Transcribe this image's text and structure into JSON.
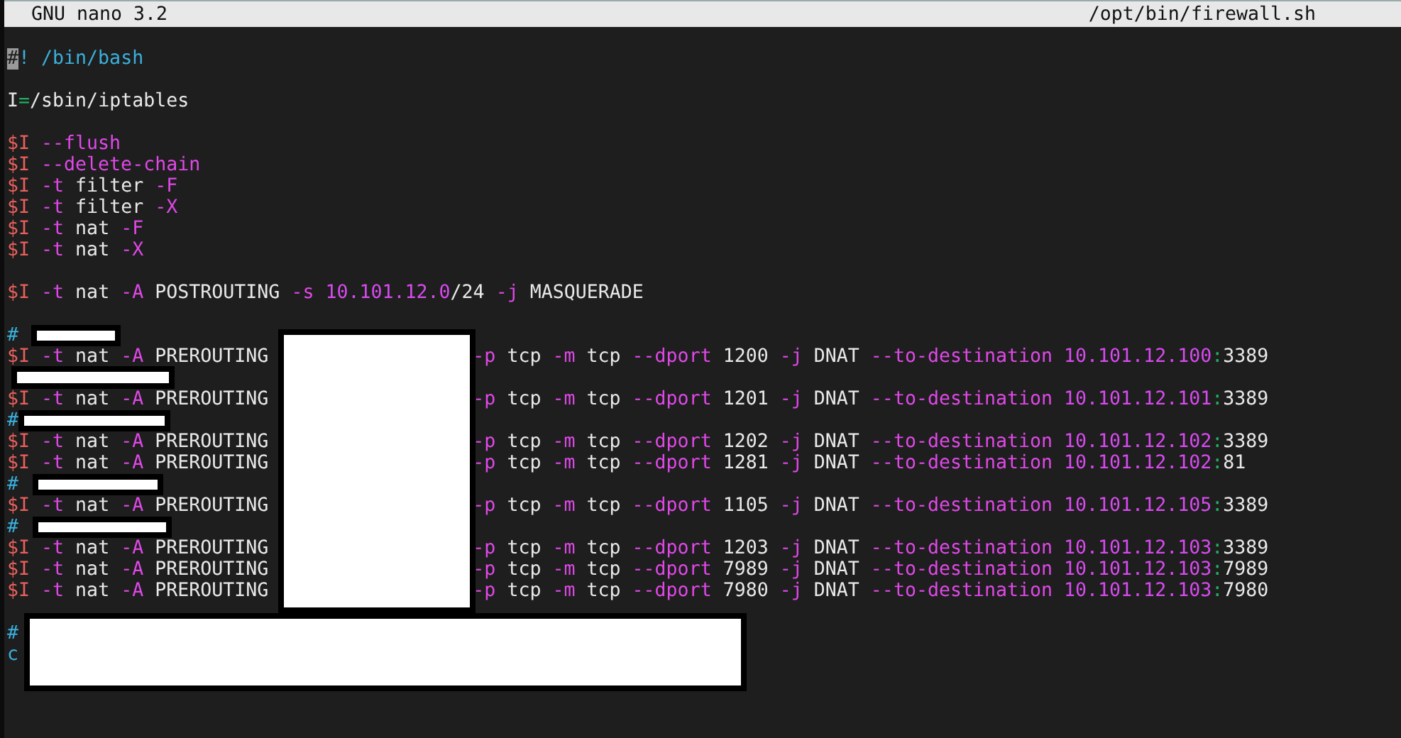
{
  "title_bar": {
    "app": "GNU nano 3.2",
    "file": "/opt/bin/firewall.sh"
  },
  "lines": [
    {
      "kind": "code",
      "segments": [
        {
          "kind": "cursor",
          "text": "#"
        },
        {
          "kind": "comment",
          "text": "! /bin/bash"
        }
      ]
    },
    {
      "kind": "blank"
    },
    {
      "kind": "code",
      "segments": [
        {
          "kind": "plain",
          "text": "I"
        },
        {
          "kind": "op",
          "text": "="
        },
        {
          "kind": "plain",
          "text": "/sbin/iptables"
        }
      ]
    },
    {
      "kind": "blank"
    },
    {
      "kind": "code",
      "segments": [
        {
          "kind": "var",
          "text": "$I"
        },
        {
          "kind": "opt",
          "text": " --flush"
        }
      ]
    },
    {
      "kind": "code",
      "segments": [
        {
          "kind": "var",
          "text": "$I"
        },
        {
          "kind": "opt",
          "text": " --delete-chain"
        }
      ]
    },
    {
      "kind": "code",
      "segments": [
        {
          "kind": "var",
          "text": "$I"
        },
        {
          "kind": "opt",
          "text": " -t"
        },
        {
          "kind": "plain",
          "text": " filter"
        },
        {
          "kind": "opt",
          "text": " -F"
        }
      ]
    },
    {
      "kind": "code",
      "segments": [
        {
          "kind": "var",
          "text": "$I"
        },
        {
          "kind": "opt",
          "text": " -t"
        },
        {
          "kind": "plain",
          "text": " filter"
        },
        {
          "kind": "opt",
          "text": " -X"
        }
      ]
    },
    {
      "kind": "code",
      "segments": [
        {
          "kind": "var",
          "text": "$I"
        },
        {
          "kind": "opt",
          "text": " -t"
        },
        {
          "kind": "plain",
          "text": " nat"
        },
        {
          "kind": "opt",
          "text": " -F"
        }
      ]
    },
    {
      "kind": "code",
      "segments": [
        {
          "kind": "var",
          "text": "$I"
        },
        {
          "kind": "opt",
          "text": " -t"
        },
        {
          "kind": "plain",
          "text": " nat"
        },
        {
          "kind": "opt",
          "text": " -X"
        }
      ]
    },
    {
      "kind": "blank"
    },
    {
      "kind": "code",
      "segments": [
        {
          "kind": "var",
          "text": "$I"
        },
        {
          "kind": "opt",
          "text": " -t"
        },
        {
          "kind": "plain",
          "text": " nat"
        },
        {
          "kind": "opt",
          "text": " -A"
        },
        {
          "kind": "plain",
          "text": " POSTROUTING"
        },
        {
          "kind": "opt",
          "text": " -s"
        },
        {
          "kind": "num",
          "text": " 10.101.12.0"
        },
        {
          "kind": "plain",
          "text": "/24"
        },
        {
          "kind": "opt",
          "text": " -j"
        },
        {
          "kind": "plain",
          "text": " MASQUERADE"
        }
      ]
    },
    {
      "kind": "blank"
    },
    {
      "kind": "code",
      "segments": [
        {
          "kind": "comment",
          "text": "#"
        }
      ]
    },
    {
      "kind": "code",
      "segments": [
        {
          "kind": "var",
          "text": "$I"
        },
        {
          "kind": "opt",
          "text": " -t"
        },
        {
          "kind": "plain",
          "text": " nat"
        },
        {
          "kind": "opt",
          "text": " -A"
        },
        {
          "kind": "plain",
          "text": " PREROUTING"
        },
        {
          "kind": "gap"
        },
        {
          "kind": "opt",
          "text": "-p"
        },
        {
          "kind": "plain",
          "text": " tcp"
        },
        {
          "kind": "opt",
          "text": " -m"
        },
        {
          "kind": "plain",
          "text": " tcp"
        },
        {
          "kind": "opt",
          "text": " --dport"
        },
        {
          "kind": "plain",
          "text": " 1200"
        },
        {
          "kind": "opt",
          "text": " -j"
        },
        {
          "kind": "plain",
          "text": " DNAT"
        },
        {
          "kind": "opt",
          "text": " --to-destination"
        },
        {
          "kind": "num",
          "text": " 10.101.12.100"
        },
        {
          "kind": "op",
          "text": ":"
        },
        {
          "kind": "plain",
          "text": "3389"
        }
      ]
    },
    {
      "kind": "blank"
    },
    {
      "kind": "code",
      "segments": [
        {
          "kind": "var",
          "text": "$I"
        },
        {
          "kind": "opt",
          "text": " -t"
        },
        {
          "kind": "plain",
          "text": " nat"
        },
        {
          "kind": "opt",
          "text": " -A"
        },
        {
          "kind": "plain",
          "text": " PREROUTING"
        },
        {
          "kind": "gap"
        },
        {
          "kind": "opt",
          "text": "-p"
        },
        {
          "kind": "plain",
          "text": " tcp"
        },
        {
          "kind": "opt",
          "text": " -m"
        },
        {
          "kind": "plain",
          "text": " tcp"
        },
        {
          "kind": "opt",
          "text": " --dport"
        },
        {
          "kind": "plain",
          "text": " 1201"
        },
        {
          "kind": "opt",
          "text": " -j"
        },
        {
          "kind": "plain",
          "text": " DNAT"
        },
        {
          "kind": "opt",
          "text": " --to-destination"
        },
        {
          "kind": "num",
          "text": " 10.101.12.101"
        },
        {
          "kind": "op",
          "text": ":"
        },
        {
          "kind": "plain",
          "text": "3389"
        }
      ]
    },
    {
      "kind": "code",
      "segments": [
        {
          "kind": "comment",
          "text": "#"
        }
      ]
    },
    {
      "kind": "code",
      "segments": [
        {
          "kind": "var",
          "text": "$I"
        },
        {
          "kind": "opt",
          "text": " -t"
        },
        {
          "kind": "plain",
          "text": " nat"
        },
        {
          "kind": "opt",
          "text": " -A"
        },
        {
          "kind": "plain",
          "text": " PREROUTING"
        },
        {
          "kind": "gap"
        },
        {
          "kind": "opt",
          "text": "-p"
        },
        {
          "kind": "plain",
          "text": " tcp"
        },
        {
          "kind": "opt",
          "text": " -m"
        },
        {
          "kind": "plain",
          "text": " tcp"
        },
        {
          "kind": "opt",
          "text": " --dport"
        },
        {
          "kind": "plain",
          "text": " 1202"
        },
        {
          "kind": "opt",
          "text": " -j"
        },
        {
          "kind": "plain",
          "text": " DNAT"
        },
        {
          "kind": "opt",
          "text": " --to-destination"
        },
        {
          "kind": "num",
          "text": " 10.101.12.102"
        },
        {
          "kind": "op",
          "text": ":"
        },
        {
          "kind": "plain",
          "text": "3389"
        }
      ]
    },
    {
      "kind": "code",
      "segments": [
        {
          "kind": "var",
          "text": "$I"
        },
        {
          "kind": "opt",
          "text": " -t"
        },
        {
          "kind": "plain",
          "text": " nat"
        },
        {
          "kind": "opt",
          "text": " -A"
        },
        {
          "kind": "plain",
          "text": " PREROUTING"
        },
        {
          "kind": "gap"
        },
        {
          "kind": "opt",
          "text": "-p"
        },
        {
          "kind": "plain",
          "text": " tcp"
        },
        {
          "kind": "opt",
          "text": " -m"
        },
        {
          "kind": "plain",
          "text": " tcp"
        },
        {
          "kind": "opt",
          "text": " --dport"
        },
        {
          "kind": "plain",
          "text": " 1281"
        },
        {
          "kind": "opt",
          "text": " -j"
        },
        {
          "kind": "plain",
          "text": " DNAT"
        },
        {
          "kind": "opt",
          "text": " --to-destination"
        },
        {
          "kind": "num",
          "text": " 10.101.12.102"
        },
        {
          "kind": "op",
          "text": ":"
        },
        {
          "kind": "plain",
          "text": "81"
        }
      ]
    },
    {
      "kind": "code",
      "segments": [
        {
          "kind": "comment",
          "text": "#"
        }
      ]
    },
    {
      "kind": "code",
      "segments": [
        {
          "kind": "var",
          "text": "$I"
        },
        {
          "kind": "opt",
          "text": " -t"
        },
        {
          "kind": "plain",
          "text": " nat"
        },
        {
          "kind": "opt",
          "text": " -A"
        },
        {
          "kind": "plain",
          "text": " PREROUTING"
        },
        {
          "kind": "gap"
        },
        {
          "kind": "opt",
          "text": "-p"
        },
        {
          "kind": "plain",
          "text": " tcp"
        },
        {
          "kind": "opt",
          "text": " -m"
        },
        {
          "kind": "plain",
          "text": " tcp"
        },
        {
          "kind": "opt",
          "text": " --dport"
        },
        {
          "kind": "plain",
          "text": " 1105"
        },
        {
          "kind": "opt",
          "text": " -j"
        },
        {
          "kind": "plain",
          "text": " DNAT"
        },
        {
          "kind": "opt",
          "text": " --to-destination"
        },
        {
          "kind": "num",
          "text": " 10.101.12.105"
        },
        {
          "kind": "op",
          "text": ":"
        },
        {
          "kind": "plain",
          "text": "3389"
        }
      ]
    },
    {
      "kind": "code",
      "segments": [
        {
          "kind": "comment",
          "text": "#"
        }
      ]
    },
    {
      "kind": "code",
      "segments": [
        {
          "kind": "var",
          "text": "$I"
        },
        {
          "kind": "opt",
          "text": " -t"
        },
        {
          "kind": "plain",
          "text": " nat"
        },
        {
          "kind": "opt",
          "text": " -A"
        },
        {
          "kind": "plain",
          "text": " PREROUTING"
        },
        {
          "kind": "gap"
        },
        {
          "kind": "opt",
          "text": "-p"
        },
        {
          "kind": "plain",
          "text": " tcp"
        },
        {
          "kind": "opt",
          "text": " -m"
        },
        {
          "kind": "plain",
          "text": " tcp"
        },
        {
          "kind": "opt",
          "text": " --dport"
        },
        {
          "kind": "plain",
          "text": " 1203"
        },
        {
          "kind": "opt",
          "text": " -j"
        },
        {
          "kind": "plain",
          "text": " DNAT"
        },
        {
          "kind": "opt",
          "text": " --to-destination"
        },
        {
          "kind": "num",
          "text": " 10.101.12.103"
        },
        {
          "kind": "op",
          "text": ":"
        },
        {
          "kind": "plain",
          "text": "3389"
        }
      ]
    },
    {
      "kind": "code",
      "segments": [
        {
          "kind": "var",
          "text": "$I"
        },
        {
          "kind": "opt",
          "text": " -t"
        },
        {
          "kind": "plain",
          "text": " nat"
        },
        {
          "kind": "opt",
          "text": " -A"
        },
        {
          "kind": "plain",
          "text": " PREROUTING"
        },
        {
          "kind": "gap"
        },
        {
          "kind": "opt",
          "text": "-p"
        },
        {
          "kind": "plain",
          "text": " tcp"
        },
        {
          "kind": "opt",
          "text": " -m"
        },
        {
          "kind": "plain",
          "text": " tcp"
        },
        {
          "kind": "opt",
          "text": " --dport"
        },
        {
          "kind": "plain",
          "text": " 7989"
        },
        {
          "kind": "opt",
          "text": " -j"
        },
        {
          "kind": "plain",
          "text": " DNAT"
        },
        {
          "kind": "opt",
          "text": " --to-destination"
        },
        {
          "kind": "num",
          "text": " 10.101.12.103"
        },
        {
          "kind": "op",
          "text": ":"
        },
        {
          "kind": "plain",
          "text": "7989"
        }
      ]
    },
    {
      "kind": "code",
      "segments": [
        {
          "kind": "var",
          "text": "$I"
        },
        {
          "kind": "opt",
          "text": " -t"
        },
        {
          "kind": "plain",
          "text": " nat"
        },
        {
          "kind": "opt",
          "text": " -A"
        },
        {
          "kind": "plain",
          "text": " PREROUTING"
        },
        {
          "kind": "gap"
        },
        {
          "kind": "opt",
          "text": "-p"
        },
        {
          "kind": "plain",
          "text": " tcp"
        },
        {
          "kind": "opt",
          "text": " -m"
        },
        {
          "kind": "plain",
          "text": " tcp"
        },
        {
          "kind": "opt",
          "text": " --dport"
        },
        {
          "kind": "plain",
          "text": " 7980"
        },
        {
          "kind": "opt",
          "text": " -j"
        },
        {
          "kind": "plain",
          "text": " DNAT"
        },
        {
          "kind": "opt",
          "text": " --to-destination"
        },
        {
          "kind": "num",
          "text": " 10.101.12.103"
        },
        {
          "kind": "op",
          "text": ":"
        },
        {
          "kind": "plain",
          "text": "7980"
        }
      ]
    },
    {
      "kind": "blank"
    },
    {
      "kind": "code",
      "segments": [
        {
          "kind": "comment",
          "text": "#"
        }
      ]
    },
    {
      "kind": "code",
      "segments": [
        {
          "kind": "comment",
          "text": "c"
        }
      ]
    }
  ]
}
